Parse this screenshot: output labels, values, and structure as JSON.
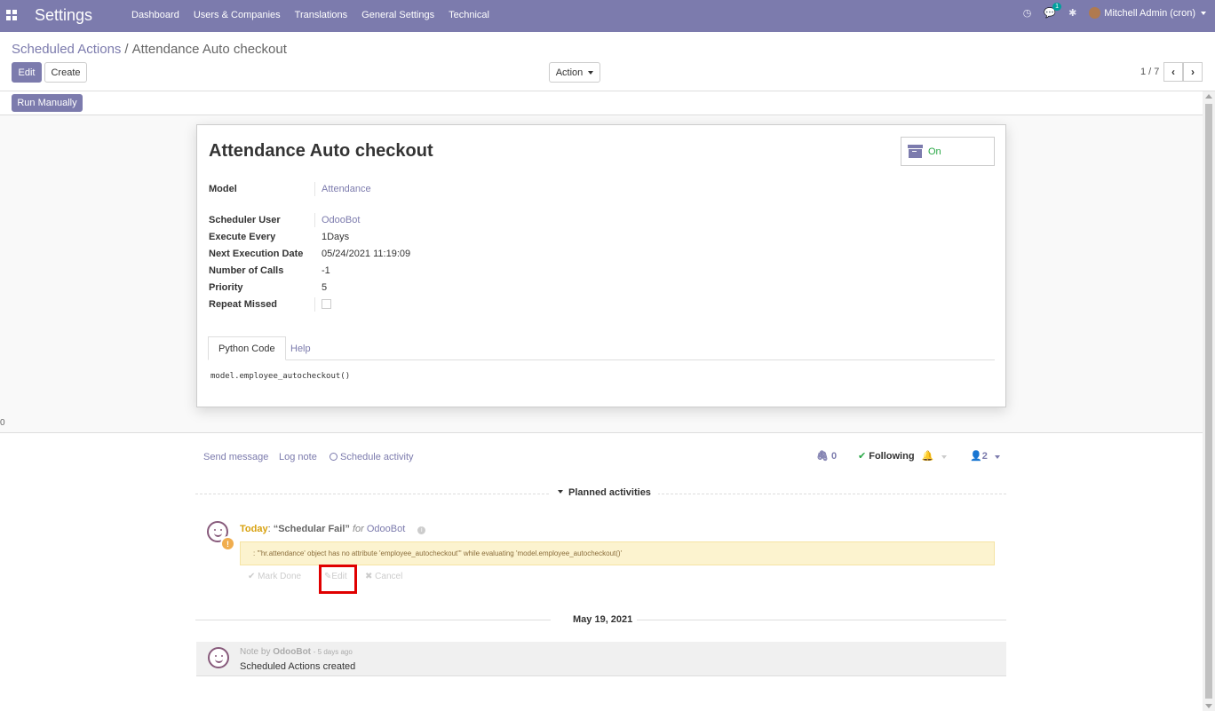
{
  "navbar": {
    "brand": "Settings",
    "menu": [
      "Dashboard",
      "Users & Companies",
      "Translations",
      "General Settings",
      "Technical"
    ],
    "messages_count": "1",
    "user": "Mitchell Admin (cron)"
  },
  "breadcrumb": {
    "parent": "Scheduled Actions",
    "separator": "/",
    "current": "Attendance Auto checkout"
  },
  "toolbar": {
    "edit_label": "Edit",
    "create_label": "Create",
    "action_label": "Action",
    "pager": "1 / 7",
    "run_manually_label": "Run Manually"
  },
  "stray_text": "0",
  "record": {
    "title": "Attendance Auto checkout",
    "active_label": "On",
    "fields": {
      "model_label": "Model",
      "model_value": "Attendance",
      "scheduler_user_label": "Scheduler User",
      "scheduler_user_value": "OdooBot",
      "execute_every_label": "Execute Every",
      "execute_every_value": "1Days",
      "next_execution_label": "Next Execution Date",
      "next_execution_value": "05/24/2021 11:19:09",
      "number_of_calls_label": "Number of Calls",
      "number_of_calls_value": "-1",
      "priority_label": "Priority",
      "priority_value": "5",
      "repeat_missed_label": "Repeat Missed"
    },
    "tabs": [
      "Python Code",
      "Help"
    ],
    "code": "model.employee_autocheckout()"
  },
  "chatter": {
    "send_message": "Send message",
    "log_note": "Log note",
    "schedule_activity": "Schedule activity",
    "attachments_count": "0",
    "following_label": "Following",
    "followers_count": "2",
    "planned_activities_label": "Planned activities",
    "activity": {
      "due": "Today",
      "summary": "“Schedular Fail”",
      "for_label": "for",
      "assignee": "OdooBot",
      "note": ": '\"hr.attendance' object has no attribute 'employee_autocheckout'\" while evaluating 'model.employee_autocheckout()'",
      "mark_done": "Mark Done",
      "edit": "Edit",
      "cancel": "Cancel"
    },
    "date_separator": "May 19, 2021",
    "message": {
      "prefix": "Note by",
      "author": "OdooBot",
      "time": "- 5 days ago",
      "body": "Scheduled Actions created"
    }
  },
  "colors": {
    "brand": "#7c7bad",
    "today": "#d8a10e",
    "highlight": "#e00000"
  }
}
